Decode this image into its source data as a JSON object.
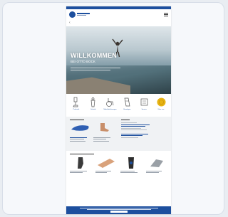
{
  "hero": {
    "title": "WILLKOMMEN",
    "subtitle": "BEI OTTO BOCK"
  },
  "categories": [
    {
      "label": "Prothetik",
      "icon": "prosthesis-leg-icon"
    },
    {
      "label": "Orthetik",
      "icon": "orthosis-icon"
    },
    {
      "label": "Mobilitätslösungen",
      "icon": "wheelchair-icon"
    },
    {
      "label": "Bandagen",
      "icon": "bandage-icon"
    },
    {
      "label": "Service",
      "icon": "service-icon"
    },
    {
      "label": "Über uns",
      "icon": "about-badge-icon"
    }
  ],
  "colors": {
    "brand": "#1d4f9e",
    "accent": "#e6b312",
    "footer": "#1d4f9e"
  }
}
